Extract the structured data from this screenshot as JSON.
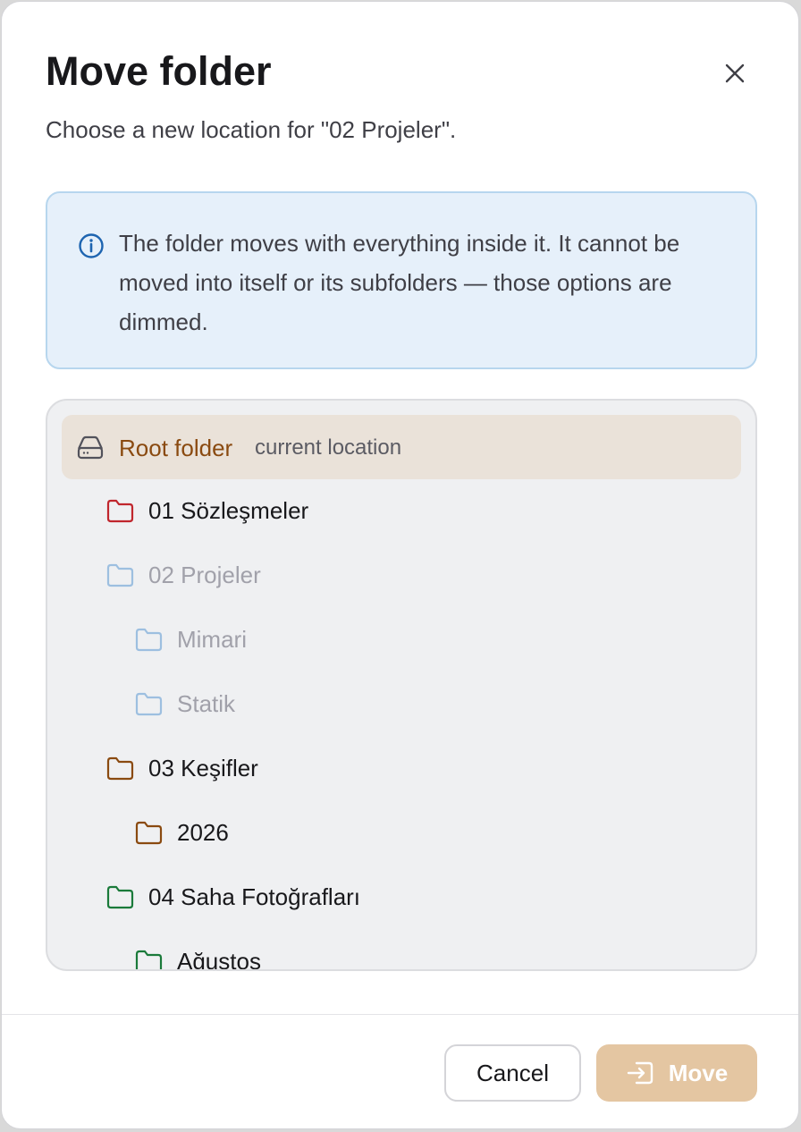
{
  "dialog": {
    "title": "Move folder",
    "subtitle": "Choose a new location for \"02 Projeler\".",
    "close_icon": "close-icon"
  },
  "info": {
    "icon": "info-icon",
    "text": "The folder moves with everything inside it. It cannot be moved into itself or its subfolders — those options are dimmed."
  },
  "tree": {
    "root": {
      "icon": "drive-icon",
      "label": "Root folder",
      "note": "current location",
      "color": "#8a4a10"
    },
    "items": [
      {
        "label": "01 Sözleşmeler",
        "level": 1,
        "color": "#c0262d",
        "dimmed": false
      },
      {
        "label": "02 Projeler",
        "level": 1,
        "color": "#9dbfe0",
        "dimmed": true
      },
      {
        "label": "Mimari",
        "level": 2,
        "color": "#9dbfe0",
        "dimmed": true
      },
      {
        "label": "Statik",
        "level": 2,
        "color": "#9dbfe0",
        "dimmed": true
      },
      {
        "label": "03 Keşifler",
        "level": 1,
        "color": "#8a4a10",
        "dimmed": false
      },
      {
        "label": "2026",
        "level": 2,
        "color": "#8a4a10",
        "dimmed": false
      },
      {
        "label": "04 Saha Fotoğrafları",
        "level": 1,
        "color": "#1a7a3a",
        "dimmed": false
      },
      {
        "label": "Ağustos",
        "level": 2,
        "color": "#1a7a3a",
        "dimmed": false
      }
    ]
  },
  "footer": {
    "cancel_label": "Cancel",
    "move_label": "Move",
    "move_icon": "move-into-icon",
    "move_color": "#e4c6a2"
  }
}
